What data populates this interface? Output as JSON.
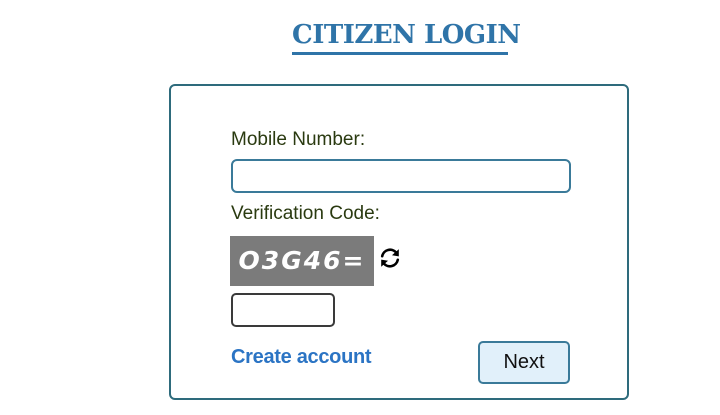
{
  "page": {
    "title": "CITIZEN LOGIN"
  },
  "form": {
    "mobile_label": "Mobile Number:",
    "mobile_value": "",
    "verification_label": "Verification Code:",
    "captcha_text": "O3G46=",
    "code_value": "",
    "create_account_label": "Create account",
    "next_label": "Next"
  },
  "icons": {
    "refresh": "refresh-icon"
  },
  "colors": {
    "title": "#2f74a8",
    "link": "#2b74c4",
    "card_border": "#2e6b7c",
    "button_bg": "#e1f0fa",
    "captcha_bg": "#7b7b7b"
  }
}
